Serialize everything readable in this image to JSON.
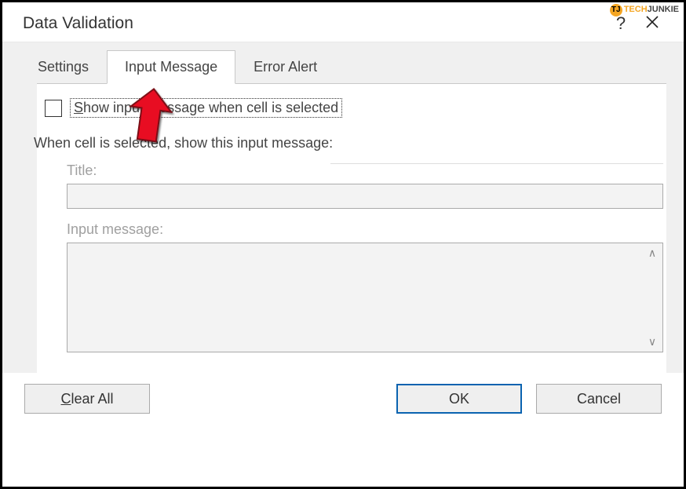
{
  "watermark": {
    "brand_prefix": "TECH",
    "brand_suffix": "JUNKIE",
    "logo_initials": "TJ"
  },
  "dialog": {
    "title": "Data Validation",
    "help_symbol": "?",
    "tabs": {
      "settings": "Settings",
      "input_message": "Input Message",
      "error_alert": "Error Alert",
      "active_index": 1
    },
    "checkbox": {
      "checked": false,
      "label_before_underline": "S",
      "label_after": "how input message when cell is selected"
    },
    "section_heading": "When cell is selected, show this input message:",
    "fields": {
      "title_label": "Title:",
      "title_value": "",
      "message_label": "Input message:",
      "message_value": "",
      "disabled": true
    },
    "buttons": {
      "clear_prefix": "C",
      "clear_suffix": "lear All",
      "ok": "OK",
      "cancel": "Cancel"
    }
  }
}
